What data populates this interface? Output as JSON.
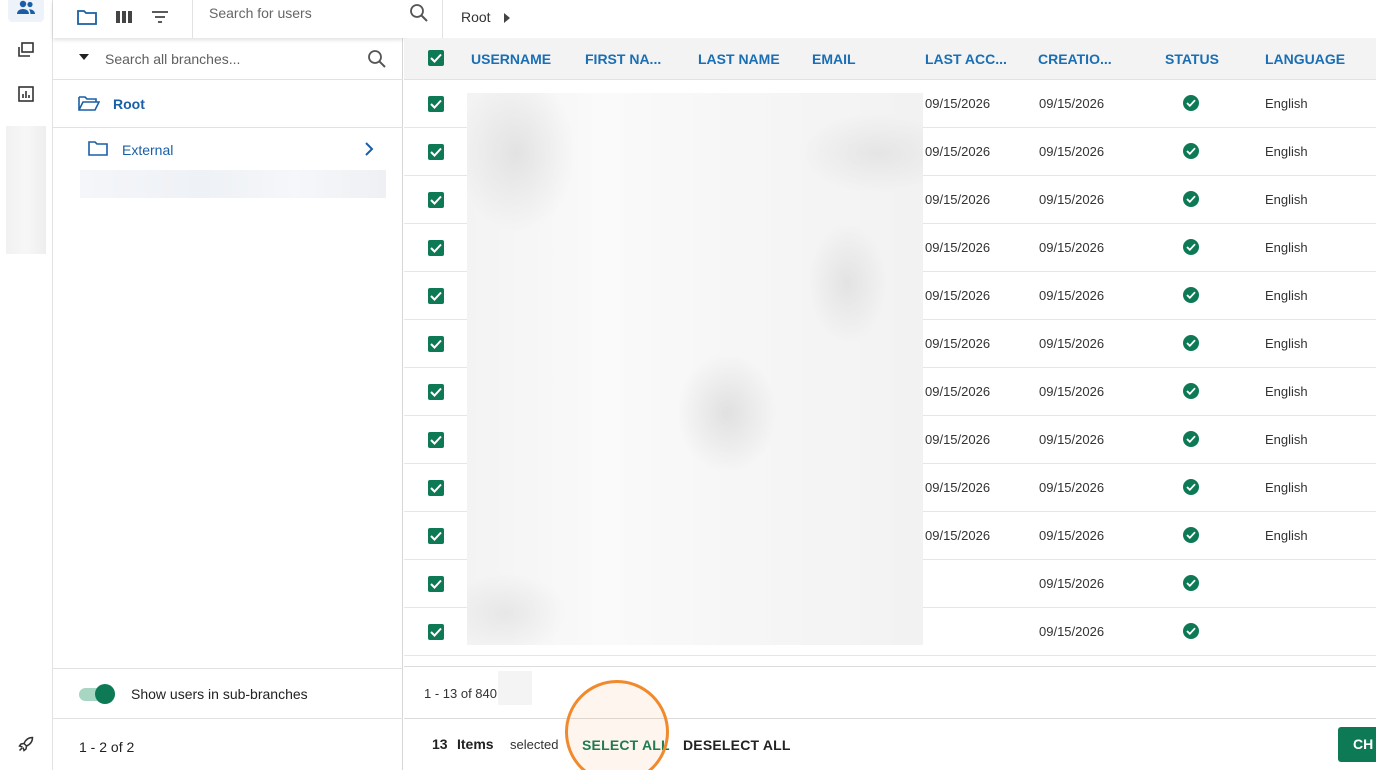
{
  "colors": {
    "accent_green": "#0e7a55",
    "header_blue": "#1a6fb4",
    "link_blue": "#1a5fa6",
    "highlight_orange": "#f08a2c"
  },
  "rail": {
    "icons": [
      "users-icon",
      "layers-icon",
      "chart-icon",
      "rocket-icon"
    ]
  },
  "toolbar": {
    "icons": [
      "folder-icon",
      "columns-icon",
      "filter-icon"
    ],
    "search_placeholder": "Search for users"
  },
  "breadcrumb": {
    "root": "Root"
  },
  "branches": {
    "search_placeholder": "Search all branches...",
    "root_label": "Root",
    "items": [
      {
        "label": "External"
      }
    ],
    "show_subbranches_label": "Show users in sub-branches",
    "pagination": "1 - 2 of 2"
  },
  "table": {
    "columns": [
      "USERNAME",
      "FIRST NA...",
      "LAST NAME",
      "EMAIL",
      "LAST ACC...",
      "CREATIO...",
      "STATUS",
      "LANGUAGE"
    ],
    "rows": [
      {
        "last_access": "09/15/2026",
        "created": "09/15/2026",
        "language": "English"
      },
      {
        "last_access": "09/15/2026",
        "created": "09/15/2026",
        "language": "English"
      },
      {
        "last_access": "09/15/2026",
        "created": "09/15/2026",
        "language": "English"
      },
      {
        "last_access": "09/15/2026",
        "created": "09/15/2026",
        "language": "English"
      },
      {
        "last_access": "09/15/2026",
        "created": "09/15/2026",
        "language": "English"
      },
      {
        "last_access": "09/15/2026",
        "created": "09/15/2026",
        "language": "English"
      },
      {
        "last_access": "09/15/2026",
        "created": "09/15/2026",
        "language": "English"
      },
      {
        "last_access": "09/15/2026",
        "created": "09/15/2026",
        "language": "English"
      },
      {
        "last_access": "09/15/2026",
        "created": "09/15/2026",
        "language": "English"
      },
      {
        "last_access": "09/15/2026",
        "created": "09/15/2026",
        "language": "English"
      },
      {
        "last_access": "",
        "created": "09/15/2026",
        "language": ""
      },
      {
        "last_access": "",
        "created": "09/15/2026",
        "language": ""
      }
    ],
    "pagination": "1 - 13 of 840"
  },
  "selection": {
    "count": "13",
    "items_label": "Items",
    "selected_label": "selected",
    "select_all": "SELECT ALL",
    "deselect_all": "DESELECT ALL",
    "cta_label": "CH"
  }
}
